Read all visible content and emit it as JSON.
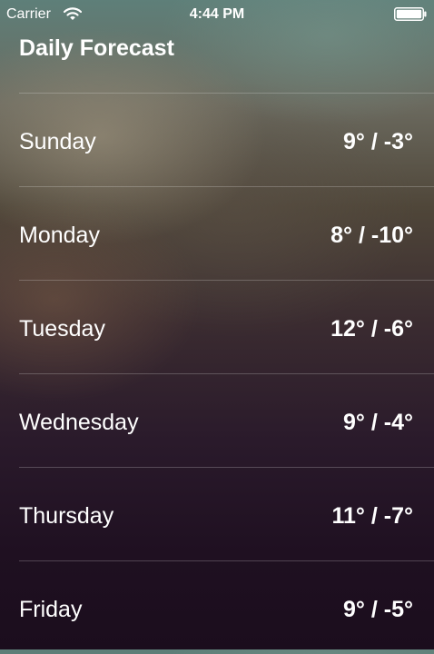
{
  "status_bar": {
    "carrier": "Carrier",
    "time": "4:44 PM",
    "wifi_icon": "wifi-icon",
    "battery_icon": "battery-icon"
  },
  "title": "Daily Forecast",
  "forecast": [
    {
      "day": "Sunday",
      "temps": "9° / -3°"
    },
    {
      "day": "Monday",
      "temps": "8° / -10°"
    },
    {
      "day": "Tuesday",
      "temps": "12° / -6°"
    },
    {
      "day": "Wednesday",
      "temps": "9° / -4°"
    },
    {
      "day": "Thursday",
      "temps": "11° / -7°"
    },
    {
      "day": "Friday",
      "temps": "9° / -5°"
    }
  ]
}
